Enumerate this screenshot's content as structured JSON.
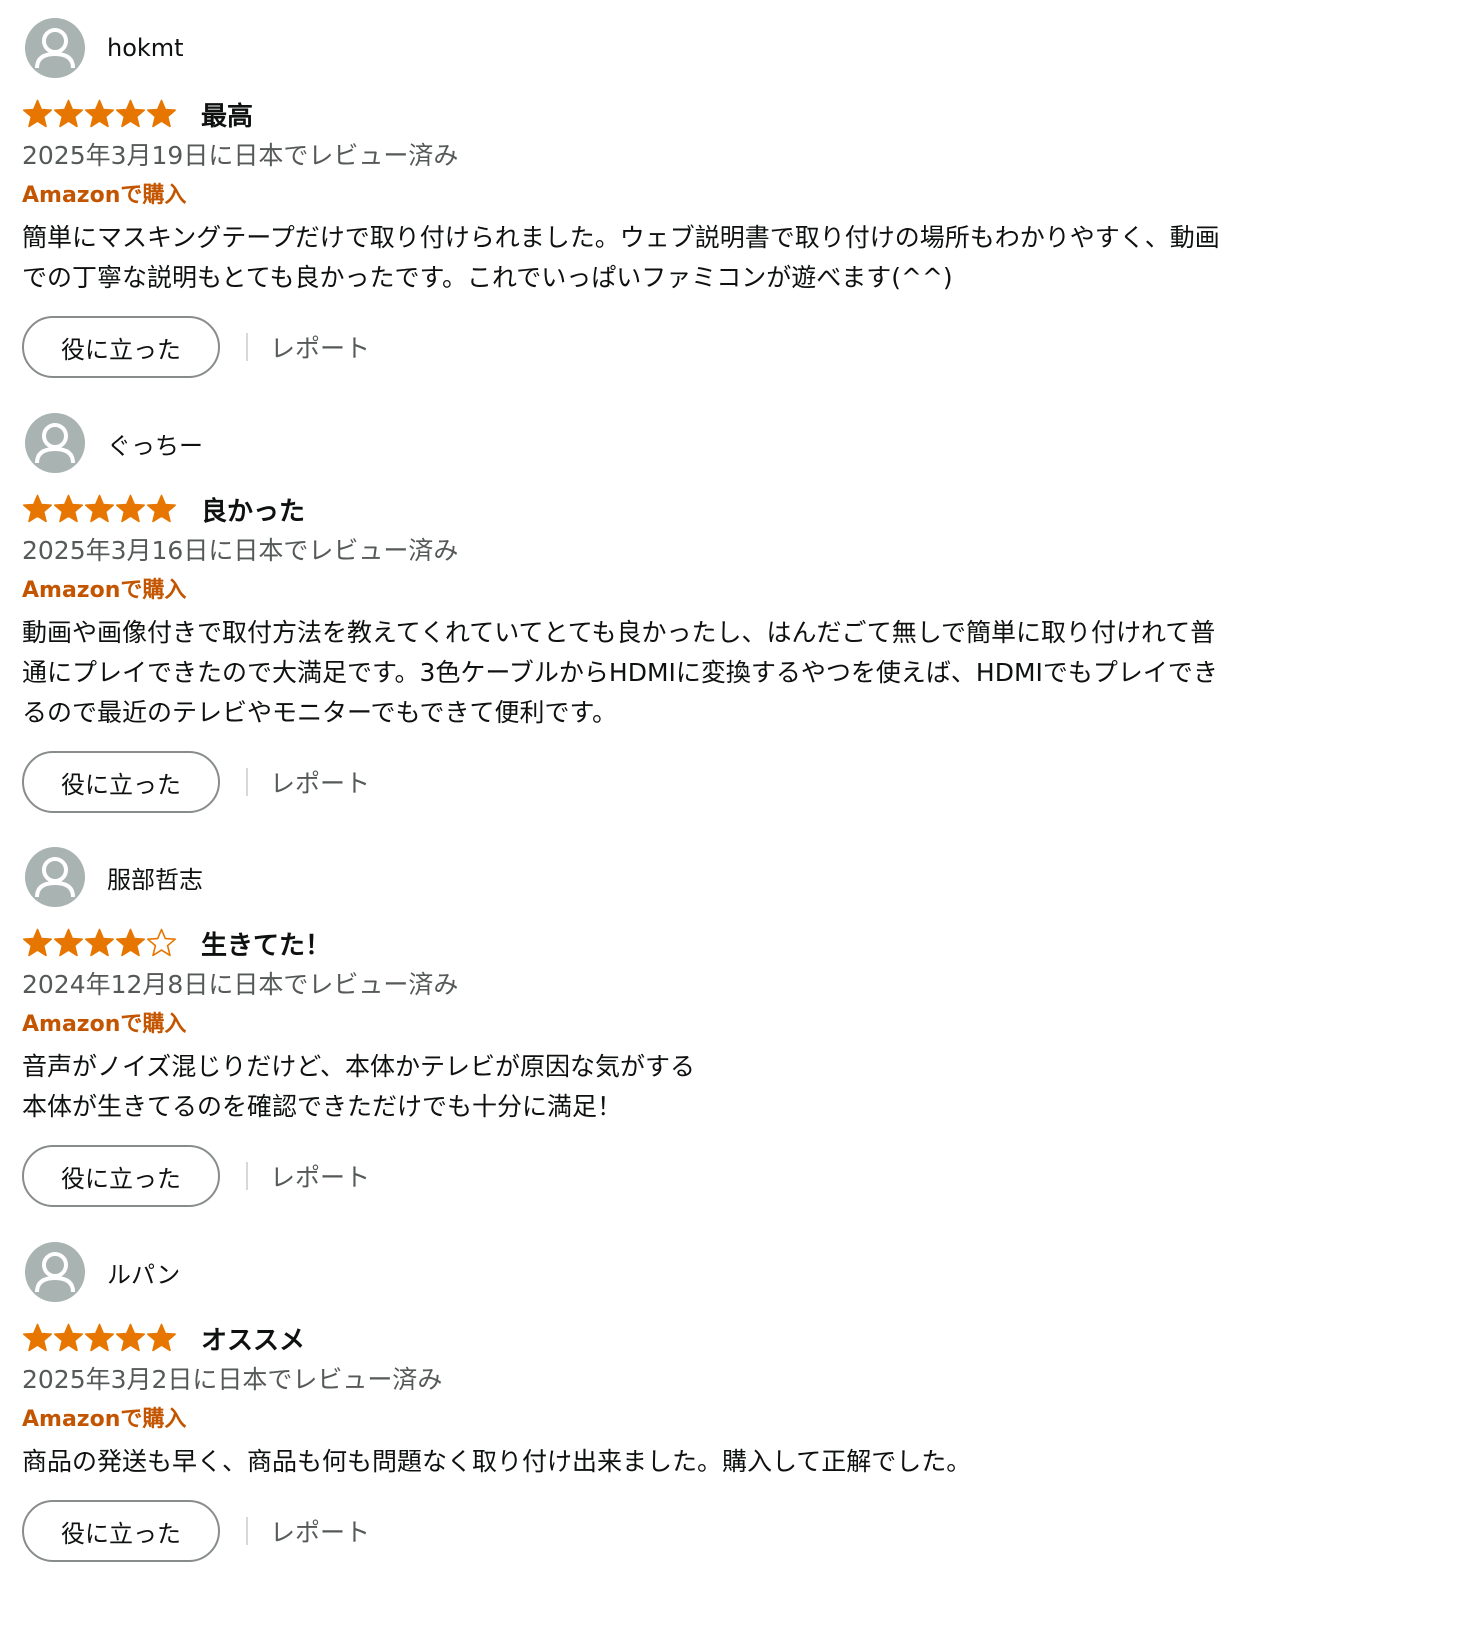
{
  "colors": {
    "star_fill": "#e77600",
    "badge": "#c45500",
    "avatar": "#a8b3b2",
    "secondary_text": "#565959"
  },
  "icons": {
    "avatar": "person-silhouette-icon",
    "star_full": "star-filled-icon",
    "star_empty": "star-outline-icon"
  },
  "reviews": [
    {
      "author": "hokmt",
      "rating": 5,
      "headline": "最高",
      "date": "2025年3月19日に日本でレビュー済み",
      "badge": "Amazonで購入",
      "body": "簡単にマスキングテープだけで取り付けられました。ウェブ説明書で取り付けの場所もわかりやすく、動画\nでの丁寧な説明もとても良かったです。これでいっぱいファミコンが遊べます(^^)",
      "helpful_label": "役に立った",
      "report_label": "レポート"
    },
    {
      "author": "ぐっちー",
      "rating": 5,
      "headline": "良かった",
      "date": "2025年3月16日に日本でレビュー済み",
      "badge": "Amazonで購入",
      "body": "動画や画像付きで取付方法を教えてくれていてとても良かったし、はんだごて無しで簡単に取り付けれて普\n通にプレイできたので大満足です。3色ケーブルからHDMIに変換するやつを使えば、HDMIでもプレイでき\nるので最近のテレビやモニターでもできて便利です。",
      "helpful_label": "役に立った",
      "report_label": "レポート"
    },
    {
      "author": "服部哲志",
      "rating": 4,
      "headline": "生きてた！",
      "date": "2024年12月8日に日本でレビュー済み",
      "badge": "Amazonで購入",
      "body": "音声がノイズ混じりだけど、本体かテレビが原因な気がする\n本体が生きてるのを確認できただけでも十分に満足！",
      "helpful_label": "役に立った",
      "report_label": "レポート"
    },
    {
      "author": "ルパン",
      "rating": 5,
      "headline": "オススメ",
      "date": "2025年3月2日に日本でレビュー済み",
      "badge": "Amazonで購入",
      "body": "商品の発送も早く、商品も何も問題なく取り付け出来ました。購入して正解でした。",
      "helpful_label": "役に立った",
      "report_label": "レポート"
    }
  ]
}
